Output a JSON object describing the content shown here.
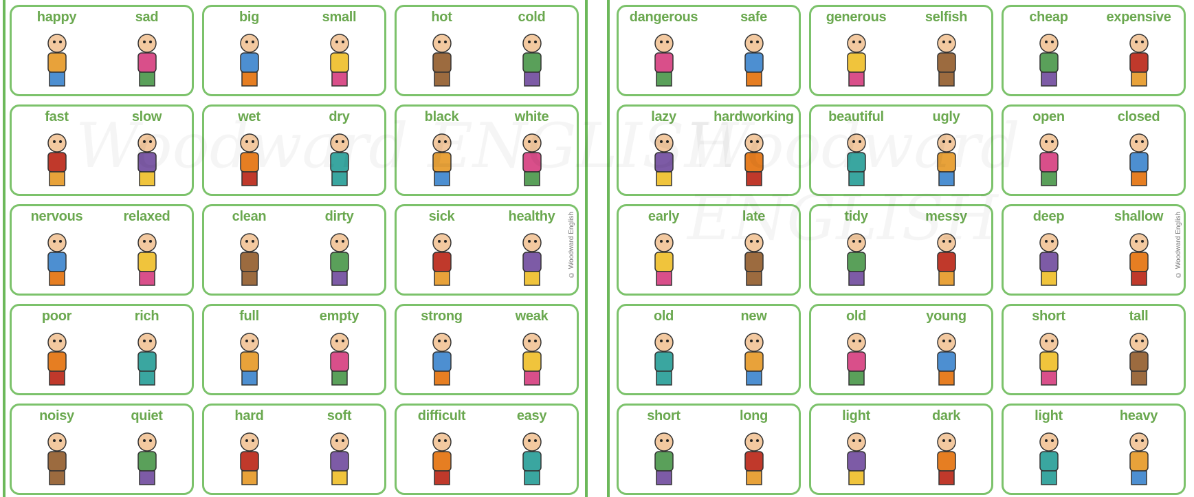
{
  "copyright": "© Woodward English",
  "watermark": "Woodward ENGLISH",
  "colors": {
    "accent": "#6aa84f",
    "border": "#7cc26b"
  },
  "panels": [
    {
      "cards": [
        {
          "left": "happy",
          "right": "sad"
        },
        {
          "left": "big",
          "right": "small"
        },
        {
          "left": "hot",
          "right": "cold"
        },
        {
          "left": "fast",
          "right": "slow"
        },
        {
          "left": "wet",
          "right": "dry"
        },
        {
          "left": "black",
          "right": "white"
        },
        {
          "left": "nervous",
          "right": "relaxed"
        },
        {
          "left": "clean",
          "right": "dirty"
        },
        {
          "left": "sick",
          "right": "healthy"
        },
        {
          "left": "poor",
          "right": "rich"
        },
        {
          "left": "full",
          "right": "empty"
        },
        {
          "left": "strong",
          "right": "weak"
        },
        {
          "left": "noisy",
          "right": "quiet"
        },
        {
          "left": "hard",
          "right": "soft"
        },
        {
          "left": "difficult",
          "right": "easy"
        }
      ]
    },
    {
      "cards": [
        {
          "left": "dangerous",
          "right": "safe"
        },
        {
          "left": "generous",
          "right": "selfish"
        },
        {
          "left": "cheap",
          "right": "expensive"
        },
        {
          "left": "lazy",
          "right": "hardworking"
        },
        {
          "left": "beautiful",
          "right": "ugly"
        },
        {
          "left": "open",
          "right": "closed"
        },
        {
          "left": "early",
          "right": "late"
        },
        {
          "left": "tidy",
          "right": "messy"
        },
        {
          "left": "deep",
          "right": "shallow"
        },
        {
          "left": "old",
          "right": "new"
        },
        {
          "left": "old",
          "right": "young"
        },
        {
          "left": "short",
          "right": "tall"
        },
        {
          "left": "short",
          "right": "long"
        },
        {
          "left": "light",
          "right": "dark"
        },
        {
          "left": "light",
          "right": "heavy"
        }
      ]
    }
  ]
}
